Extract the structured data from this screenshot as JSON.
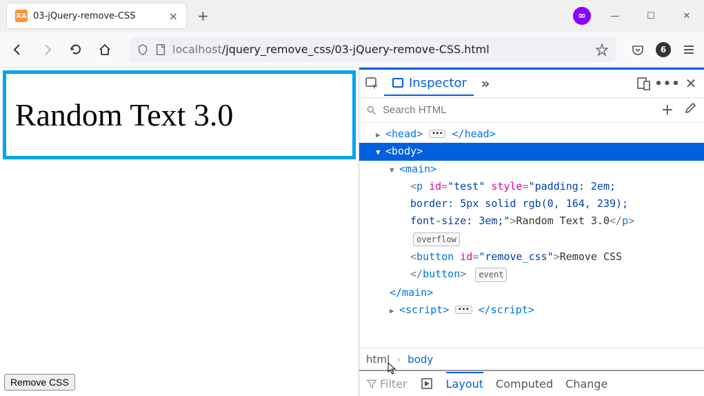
{
  "browser": {
    "tab_title": "03-jQuery-remove-CSS",
    "tab_icon_label": "XA",
    "url_host": "localhost",
    "url_path": "/jquery_remove_css/03-jQuery-remove-CSS.html",
    "badge_count": "6"
  },
  "page": {
    "heading": "Random Text 3.0",
    "button_label": "Remove CSS"
  },
  "devtools": {
    "inspector_label": "Inspector",
    "search_placeholder": "Search HTML",
    "breadcrumb": {
      "root": "html",
      "current": "body"
    },
    "filter_label": "Filter",
    "bottom_tabs": {
      "layout": "Layout",
      "computed": "Computed",
      "changes": "Change"
    },
    "tree": {
      "head_open": "<head>",
      "head_close": "</head>",
      "body_open": "<body>",
      "main_open": "<main>",
      "main_close": "</main>",
      "p_line1_a": "<",
      "p_tag": "p",
      "p_sp1": " ",
      "p_id_name": "id",
      "p_eq": "=",
      "p_id_val": "\"test\"",
      "p_sp2": " ",
      "p_style_name": "style",
      "p_style_val1": "\"padding: 2em;",
      "p_line2": "border: 5px solid rgb(0, 164, 239);",
      "p_line3_style": "font-size: 3em;\"",
      "p_gt": ">",
      "p_text": "Random Text 3.0",
      "p_close": "</",
      "p_close2": ">",
      "overflow_pill": "overflow",
      "btn_open": "<",
      "btn_tag": "button",
      "btn_id_name": "id",
      "btn_id_val": "\"remove_css\"",
      "btn_text": "Remove CSS",
      "btn_close": "</",
      "btn_close_tag": "button",
      "btn_close2": ">",
      "event_pill": "event",
      "script_open": "<script>",
      "script_close": "</script>"
    }
  }
}
